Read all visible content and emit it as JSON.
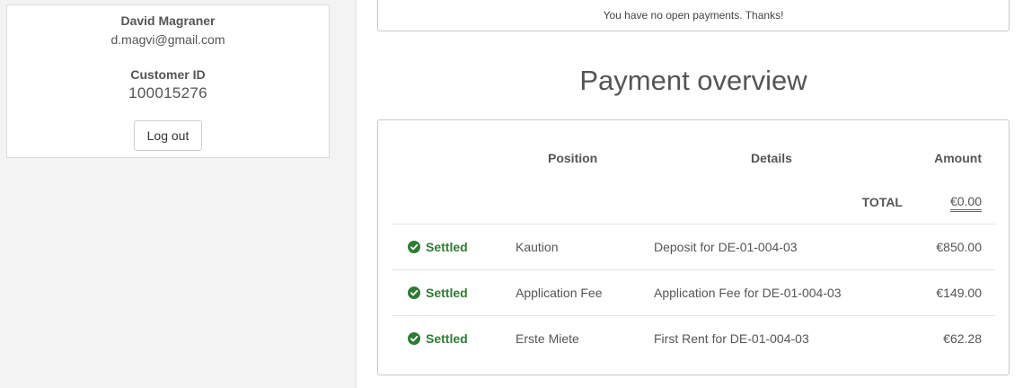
{
  "profile": {
    "name": "David Magraner",
    "email": "d.magvi@gmail.com",
    "customer_id_label": "Customer ID",
    "customer_id": "100015276",
    "logout_label": "Log out"
  },
  "notice": {
    "text": "You have no open payments. Thanks!"
  },
  "overview": {
    "title": "Payment overview",
    "columns": {
      "position": "Position",
      "details": "Details",
      "amount": "Amount"
    },
    "total_label": "TOTAL",
    "total_value": "€0.00",
    "rows": [
      {
        "status": "Settled",
        "position": "Kaution",
        "details": "Deposit for DE-01-004-03",
        "amount": "€850.00"
      },
      {
        "status": "Settled",
        "position": "Application Fee",
        "details": "Application Fee for DE-01-004-03",
        "amount": "€149.00"
      },
      {
        "status": "Settled",
        "position": "Erste Miete",
        "details": "First Rent for DE-01-004-03",
        "amount": "€62.28"
      }
    ]
  },
  "colors": {
    "settled_green": "#2f7a34",
    "sidebar_bg": "#f3f3f3",
    "border": "#c8c8c8"
  },
  "icons": {
    "status": "check-circle-icon"
  }
}
